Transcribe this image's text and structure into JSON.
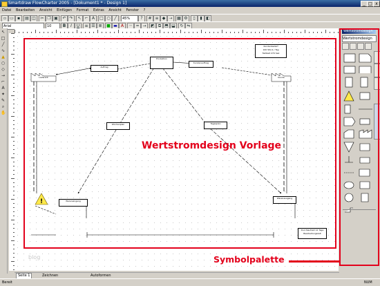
{
  "window": {
    "title": "Smartdraw FlowCharter 2005 - [Dokument1 * - Design 1]",
    "minimize": "_",
    "maximize": "□",
    "close": "x"
  },
  "menu": [
    "Datei",
    "Bearbeiten",
    "Ansicht",
    "Einfügen",
    "Format",
    "Extras",
    "Ansicht",
    "Fenster",
    "?"
  ],
  "toolbar": {
    "font_value": "Arial",
    "size_value": "10",
    "zoom_value": "45%"
  },
  "palette": {
    "header": "Wertstromdesign",
    "selector": "Wertstromdesign"
  },
  "diagram": {
    "top_center": "Produktion",
    "left_process": "Lieferant",
    "left_info": "Auftrag",
    "right_info": "Kundenauftrag",
    "right_customer": "Kunde",
    "info_box_line1": "Kundenbedarf",
    "info_box_line2": "100 Stück / Tag",
    "info_box_line3": "Taktzeit 270 Sek",
    "mid_left": "Wochenplan",
    "mid_right": "Tagesplan",
    "bottom_left": "Wareneingang",
    "bottom_right": "Warenausgang",
    "legend_line1": "Durchlaufzeit 12 Tage",
    "legend_line2": "Bearbeitungszeit"
  },
  "annotations": {
    "main_label": "Wertstromdesign Vorlage",
    "palette_label": "Symbolpalette"
  },
  "pagebar": {
    "left": "Zeichnen",
    "mid": "Autoformen",
    "tab": "Seite 1"
  },
  "status": {
    "left": "Bereit",
    "right": "NUM"
  },
  "watermark": "blog",
  "accent_color": "#e3001b"
}
